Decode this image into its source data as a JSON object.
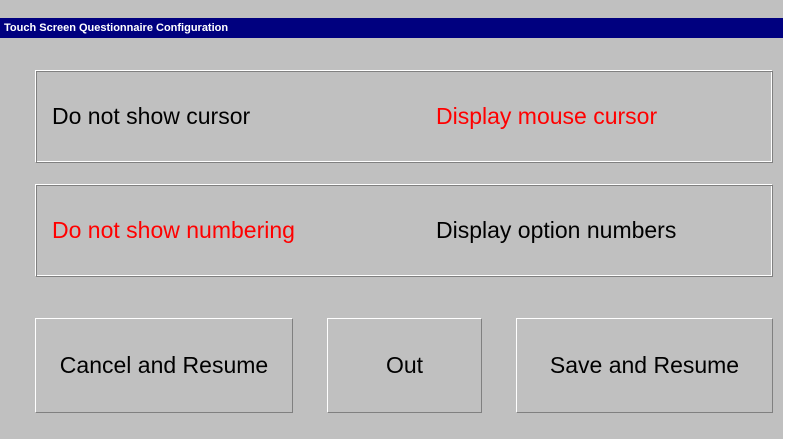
{
  "window": {
    "title": "Touch Screen Questionnaire Configuration"
  },
  "cursor_setting": {
    "options": [
      {
        "label": "Do not show cursor",
        "selected": false
      },
      {
        "label": "Display mouse cursor",
        "selected": true
      }
    ]
  },
  "numbering_setting": {
    "options": [
      {
        "label": "Do not show numbering",
        "selected": true
      },
      {
        "label": "Display option numbers",
        "selected": false
      }
    ]
  },
  "buttons": {
    "cancel_label": "Cancel and Resume",
    "out_label": "Out",
    "save_label": "Save and Resume"
  },
  "colors": {
    "title_bar": "#00007f",
    "title_text": "#ffffff",
    "background": "#c0c0c0",
    "selected_text": "#ff0000",
    "unselected_text": "#000000"
  }
}
